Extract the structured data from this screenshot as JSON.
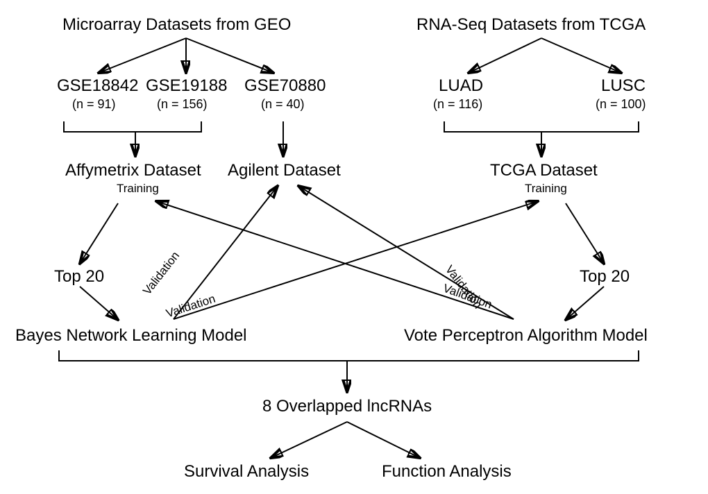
{
  "header": {
    "geo": "Microarray Datasets from GEO",
    "tcga": "RNA-Seq Datasets from TCGA"
  },
  "datasets": {
    "gse18842": {
      "name": "GSE18842",
      "n": "(n = 91)"
    },
    "gse19188": {
      "name": "GSE19188",
      "n": "(n = 156)"
    },
    "gse70880": {
      "name": "GSE70880",
      "n": "(n = 40)"
    },
    "luad": {
      "name": "LUAD",
      "n": "(n = 116)"
    },
    "lusc": {
      "name": "LUSC",
      "n": "(n = 100)"
    }
  },
  "grouped": {
    "affymetrix": {
      "name": "Affymetrix Dataset",
      "note": "Training"
    },
    "agilent": {
      "name": "Agilent Dataset"
    },
    "tcga_ds": {
      "name": "TCGA Dataset",
      "note": "Training"
    }
  },
  "top20_left": "Top 20",
  "top20_right": "Top 20",
  "models": {
    "bayes": "Bayes Network Learning Model",
    "vote": "Vote Perceptron Algorithm Model"
  },
  "overlap": "8 Overlapped lncRNAs",
  "analysis": {
    "survival": "Survival Analysis",
    "function": "Function Analysis"
  },
  "annotations": {
    "validation": "Validation"
  }
}
